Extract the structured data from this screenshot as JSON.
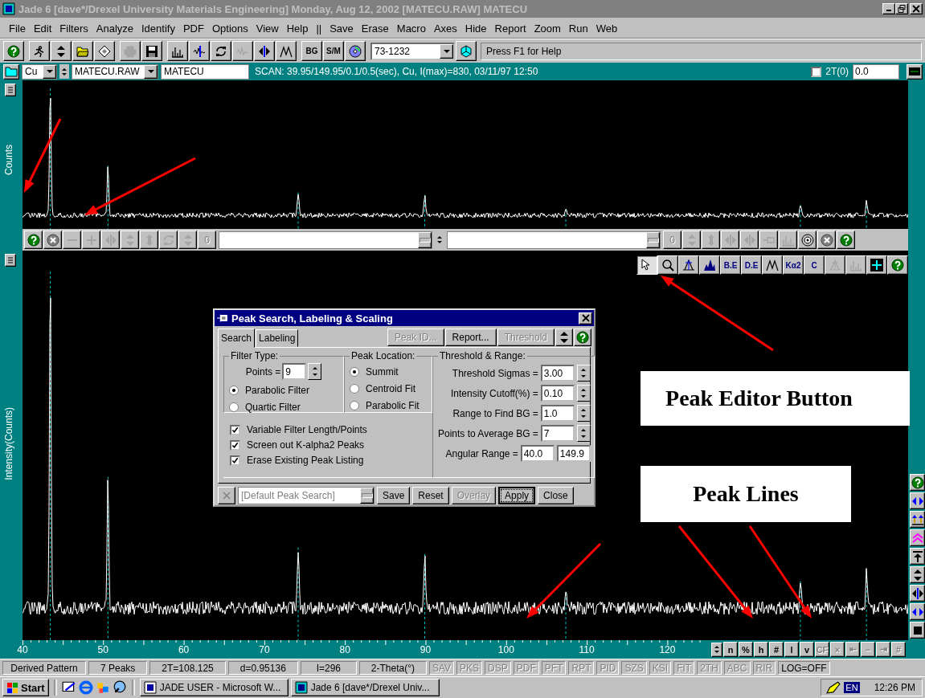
{
  "window": {
    "title": "Jade 6 [dave*/Drexel University Materials Engineering] Monday, Aug 12, 2002 [MATECU.RAW] MATECU"
  },
  "menu": [
    "File",
    "Edit",
    "Filters",
    "Analyze",
    "Identify",
    "PDF",
    "Options",
    "View",
    "Help",
    "||",
    "Save",
    "Erase",
    "Macro",
    "Axes",
    "Hide",
    "Report",
    "Zoom",
    "Run",
    "Web"
  ],
  "toolbar": [
    {
      "kind": "help",
      "disabled": false
    },
    {
      "kind": "runner",
      "disabled": false
    },
    {
      "kind": "updown",
      "disabled": false
    },
    {
      "kind": "folder",
      "disabled": false
    },
    {
      "kind": "diamond",
      "disabled": false
    },
    {
      "kind": "printer",
      "disabled": true
    },
    {
      "kind": "save",
      "disabled": false
    },
    {
      "kind": "bars",
      "disabled": false
    },
    {
      "kind": "peakwave",
      "disabled": false
    },
    {
      "kind": "refresh",
      "disabled": false
    },
    {
      "kind": "wave",
      "disabled": true
    },
    {
      "kind": "leftright",
      "disabled": false
    },
    {
      "kind": "peaks",
      "disabled": false
    },
    {
      "kind": "text",
      "label": "BG",
      "disabled": false
    },
    {
      "kind": "text",
      "label": "S/M",
      "disabled": false
    },
    {
      "kind": "disc",
      "disabled": false
    }
  ],
  "pdf_combo": {
    "value": "73-1232"
  },
  "hint": "Press F1 for Help",
  "scan_bar": {
    "element": "Cu",
    "file": "MATECU.RAW",
    "name": "MATECU",
    "scan": "SCAN: 39.95/149.95/0.1/0.5(sec), Cu, I(max)=830, 03/11/97 12:50",
    "offset_checked": false,
    "offset_label": "2T(0)",
    "offset_value": "0.0"
  },
  "upper_plot": {
    "ylabel": "Counts"
  },
  "lower_plot": {
    "ylabel": "Intensity(Counts)"
  },
  "edit_toolbar_left": [
    {
      "kind": "help",
      "disabled": false
    },
    {
      "kind": "cancel",
      "disabled": false
    },
    {
      "kind": "minus",
      "disabled": true
    },
    {
      "kind": "plus",
      "disabled": true
    },
    {
      "kind": "leftright",
      "disabled": true
    },
    {
      "kind": "updown",
      "disabled": true
    },
    {
      "kind": "updown2",
      "disabled": true
    },
    {
      "kind": "refresh",
      "disabled": true
    },
    {
      "kind": "updown",
      "disabled": true
    },
    {
      "kind": "text",
      "label": "0",
      "disabled": true
    }
  ],
  "edit_toolbar_right": [
    {
      "kind": "text",
      "label": "0",
      "disabled": true
    },
    {
      "kind": "updown",
      "disabled": true
    },
    {
      "kind": "updown2",
      "disabled": true
    },
    {
      "kind": "leftright",
      "disabled": true
    },
    {
      "kind": "leftright",
      "disabled": true
    },
    {
      "kind": "pin",
      "disabled": true
    },
    {
      "kind": "bars",
      "disabled": true
    },
    {
      "kind": "target",
      "disabled": false
    },
    {
      "kind": "cancel",
      "disabled": false
    },
    {
      "kind": "help",
      "disabled": false
    }
  ],
  "peak_tools": [
    {
      "kind": "pointer",
      "pressed": true,
      "disabled": false
    },
    {
      "kind": "magnifier",
      "pressed": false,
      "disabled": false
    },
    {
      "kind": "peakfit",
      "pressed": false,
      "disabled": false
    },
    {
      "kind": "filledpeak",
      "pressed": false,
      "disabled": false
    },
    {
      "kind": "text",
      "label": "B.E",
      "pressed": false,
      "disabled": false
    },
    {
      "kind": "text",
      "label": "D.E",
      "pressed": false,
      "disabled": false
    },
    {
      "kind": "peaks",
      "pressed": false,
      "disabled": false
    },
    {
      "kind": "text",
      "label": "Kα2",
      "pressed": false,
      "disabled": false
    },
    {
      "kind": "text",
      "label": "C",
      "pressed": false,
      "disabled": false
    },
    {
      "kind": "peakfit",
      "pressed": false,
      "disabled": true
    },
    {
      "kind": "bars",
      "pressed": false,
      "disabled": true
    },
    {
      "kind": "grid",
      "pressed": false,
      "disabled": false
    },
    {
      "kind": "help",
      "pressed": false,
      "disabled": false
    }
  ],
  "side_tools": [
    {
      "kind": "help"
    },
    {
      "kind": "leftrightblue"
    },
    {
      "kind": "uparrows"
    },
    {
      "kind": "chevrons"
    },
    {
      "kind": "uptop"
    },
    {
      "kind": "updown"
    },
    {
      "kind": "leftright"
    },
    {
      "kind": "leftrightblue"
    },
    {
      "kind": "square"
    }
  ],
  "dialog": {
    "title": "Peak Search, Labeling & Scaling",
    "tabs": [
      {
        "label": "Search",
        "selected": true
      },
      {
        "label": "Labeling",
        "selected": false
      }
    ],
    "top_buttons": [
      {
        "label": "Peak ID...",
        "disabled": true
      },
      {
        "label": "Report...",
        "disabled": false
      },
      {
        "label": "Threshold",
        "disabled": true
      }
    ],
    "filter_type": {
      "legend": "Filter Type:",
      "points_label": "Points =",
      "points": "9",
      "options": [
        {
          "label": "Parabolic Filter",
          "selected": true
        },
        {
          "label": "Quartic Filter",
          "selected": false
        }
      ]
    },
    "peak_location": {
      "legend": "Peak Location:",
      "options": [
        {
          "label": "Summit",
          "selected": true
        },
        {
          "label": "Centroid Fit",
          "selected": false
        },
        {
          "label": "Parabolic Fit",
          "selected": false
        }
      ]
    },
    "checks": [
      {
        "label": "Variable Filter Length/Points",
        "checked": true
      },
      {
        "label": "Screen out K-alpha2 Peaks",
        "checked": true
      },
      {
        "label": "Erase Existing Peak Listing",
        "checked": true
      }
    ],
    "threshold": {
      "legend": "Threshold & Range:",
      "fields": [
        {
          "kind": "spin",
          "label": "Threshold Sigmas =",
          "value": "3.00"
        },
        {
          "kind": "spin",
          "label": "Intensity Cutoff(%) =",
          "value": "0.10"
        },
        {
          "kind": "spin",
          "label": "Range to Find BG =",
          "value": "1.0"
        },
        {
          "kind": "spin",
          "label": "Points to Average BG =",
          "value": "7"
        },
        {
          "kind": "range",
          "label": "Angular Range =",
          "value": "40.0",
          "value2": "149.9"
        }
      ]
    },
    "preset": {
      "value": "[Default Peak Search]",
      "disabled": true
    },
    "buttons": [
      {
        "label": "Save",
        "disabled": false,
        "default": false
      },
      {
        "label": "Reset",
        "disabled": false,
        "default": false
      },
      {
        "label": "Overlay",
        "disabled": true,
        "default": false
      },
      {
        "label": "Apply",
        "disabled": false,
        "default": true
      },
      {
        "label": "Close",
        "disabled": false,
        "default": false
      }
    ]
  },
  "axis": {
    "ticks": [
      "40",
      "50",
      "60",
      "70",
      "80",
      "90",
      "100",
      "110",
      "120"
    ],
    "buttons": [
      {
        "label": "n",
        "disabled": false
      },
      {
        "label": "%",
        "disabled": false
      },
      {
        "label": "h",
        "disabled": false
      },
      {
        "label": "#",
        "disabled": false
      },
      {
        "label": "l",
        "disabled": false
      },
      {
        "label": "v",
        "disabled": false
      },
      {
        "label": "CF",
        "disabled": true
      },
      {
        "label": "×",
        "disabled": true
      },
      {
        "label": "⇤",
        "disabled": true
      },
      {
        "label": "−",
        "disabled": true
      },
      {
        "label": "⇥",
        "disabled": true
      },
      {
        "label": "#",
        "disabled": true
      }
    ]
  },
  "status": [
    {
      "text": "Derived Pattern",
      "kind": "field",
      "disabled": false
    },
    {
      "text": "7 Peaks",
      "kind": "field",
      "disabled": false
    },
    {
      "text": "2T=108.125",
      "kind": "field",
      "disabled": false
    },
    {
      "text": "d=0.95136",
      "kind": "field",
      "disabled": false
    },
    {
      "text": "I=296",
      "kind": "field",
      "disabled": false
    },
    {
      "text": "2-Theta(°)",
      "kind": "field",
      "disabled": false
    },
    {
      "text": "SAV",
      "kind": "flag",
      "disabled": true
    },
    {
      "text": "PKS",
      "kind": "flag",
      "disabled": true
    },
    {
      "text": "DSP",
      "kind": "flag",
      "disabled": true
    },
    {
      "text": "PDF",
      "kind": "flag",
      "disabled": true
    },
    {
      "text": "PFT",
      "kind": "flag",
      "disabled": true
    },
    {
      "text": "RPT",
      "kind": "flag",
      "disabled": true
    },
    {
      "text": "PID",
      "kind": "flag",
      "disabled": true
    },
    {
      "text": "SZS",
      "kind": "flag",
      "disabled": true
    },
    {
      "text": "KSI",
      "kind": "flag",
      "disabled": true
    },
    {
      "text": "FIT",
      "kind": "flag",
      "disabled": true
    },
    {
      "text": "2TH",
      "kind": "flag",
      "disabled": true
    },
    {
      "text": "ABC",
      "kind": "flag",
      "disabled": true
    },
    {
      "text": "RIR",
      "kind": "flag",
      "disabled": true
    },
    {
      "text": "LOG=OFF",
      "kind": "flag",
      "disabled": false
    }
  ],
  "taskbar": {
    "start": "Start",
    "tasks": [
      {
        "label": "JADE USER - Microsoft W...",
        "selected": false
      },
      {
        "label": "Jade 6 [dave*/Drexel Univ...",
        "selected": false
      }
    ],
    "lang": "EN",
    "clock": "12:26 PM"
  },
  "annotations": [
    {
      "text": "Peak Editor Button"
    },
    {
      "text": "Peak Lines"
    }
  ]
}
